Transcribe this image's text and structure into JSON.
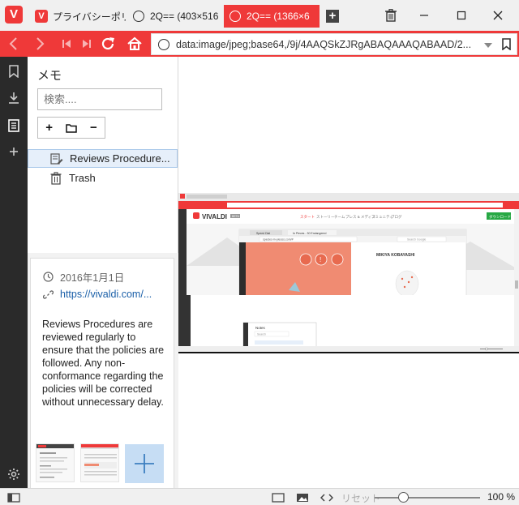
{
  "tabs": [
    {
      "label": "プライバシーポリシ",
      "icon": "vivaldi-icon",
      "active": false
    },
    {
      "label": "2Q== (403×516",
      "icon": "globe-icon",
      "active": false
    },
    {
      "label": "2Q== (1366×6",
      "icon": "globe-icon",
      "active": true
    }
  ],
  "address": {
    "url": "data:image/jpeg;base64,/9j/4AAQSkZJRgABAQAAAQABAAD/2..."
  },
  "notes": {
    "title": "メモ",
    "search_placeholder": "検索....",
    "toolbar": {
      "add": "+",
      "minus": "−"
    },
    "items": [
      {
        "label": "Reviews Procedure...",
        "selected": true,
        "icon": "note-icon"
      },
      {
        "label": "Trash",
        "selected": false,
        "icon": "trash-icon"
      }
    ],
    "detail": {
      "date": "2016年1月1日",
      "link": "https://vivaldi.com/...",
      "body": "Reviews Procedures are reviewed regularly to ensure that the policies are followed. Any non-conformance regarding the policies will be corrected without unnecessary delay."
    }
  },
  "preview": {
    "brand": "VIVALDI",
    "badge": "BETA",
    "cta": "ダウンロード",
    "nav": [
      "スタート",
      "ストーリー",
      "チーム",
      "プレス & メディア",
      "コミュニティ",
      "ブログ"
    ],
    "inner_tab": "Speed Dial",
    "inner_tab2": "In Pieces - 30 Endangered",
    "inner_url": "species-in-pieces.com/#",
    "inner_search": "Search Google",
    "author": "MIKIYA KOBAYASHI",
    "notes_title": "Notes",
    "notes_search": "Search"
  },
  "statusbar": {
    "reset": "リセット",
    "zoom": "100 %",
    "zoom_fraction": 0.27
  },
  "colors": {
    "accent": "#ef3939",
    "panel_dark": "#2a2a2a",
    "selection": "#e6effa"
  }
}
